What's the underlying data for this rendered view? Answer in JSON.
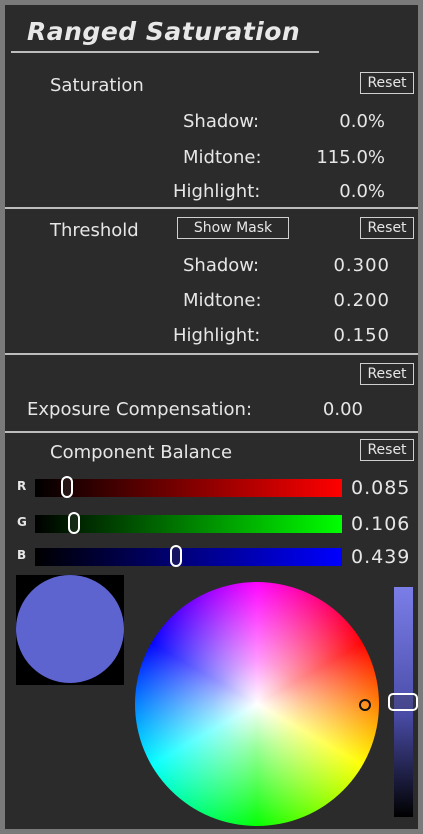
{
  "title": "Ranged Saturation",
  "saturation": {
    "label": "Saturation",
    "reset": "Reset",
    "rows": [
      {
        "label": "Shadow:",
        "value": "0.0%"
      },
      {
        "label": "Midtone:",
        "value": "115.0%"
      },
      {
        "label": "Highlight:",
        "value": "0.0%"
      }
    ]
  },
  "threshold": {
    "label": "Threshold",
    "show_mask": "Show Mask",
    "reset": "Reset",
    "rows": [
      {
        "label": "Shadow:",
        "value": "0.300"
      },
      {
        "label": "Midtone:",
        "value": "0.200"
      },
      {
        "label": "Highlight:",
        "value": "0.150"
      }
    ]
  },
  "exposure": {
    "reset": "Reset",
    "label": "Exposure Compensation:",
    "value": "0.00"
  },
  "component_balance": {
    "label": "Component Balance",
    "reset": "Reset",
    "sliders": [
      {
        "label": "R",
        "value": "0.085",
        "level": 0.085,
        "color": "#ff0000"
      },
      {
        "label": "G",
        "value": "0.106",
        "level": 0.106,
        "color": "#00ff00"
      },
      {
        "label": "B",
        "value": "0.439",
        "level": 0.439,
        "color": "#0000ff"
      }
    ]
  },
  "color_swatch": "#5d63cf",
  "brightness_level": 0.5
}
